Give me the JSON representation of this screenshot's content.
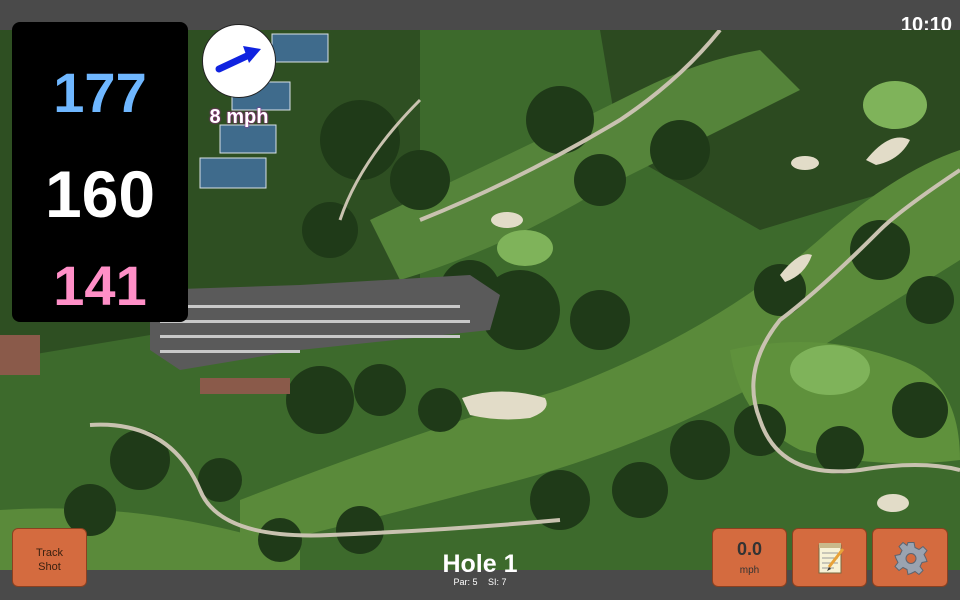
{
  "status": {
    "time": "10:10"
  },
  "distances": {
    "back": "177",
    "middle": "160",
    "front": "141"
  },
  "wind": {
    "speed_label": "8 mph",
    "icon": "wind-direction-arrow-icon"
  },
  "hole": {
    "title": "Hole 1",
    "par_label": "Par: 5",
    "si_label": "SI: 7"
  },
  "buttons": {
    "track_shot_line1": "Track",
    "track_shot_line2": "Shot",
    "speed_value": "0.0",
    "speed_unit": "mph",
    "notes_icon": "notepad-icon",
    "settings_icon": "gear-icon"
  },
  "colors": {
    "back": "#6fb7ff",
    "middle": "#ffffff",
    "front": "#ff8fc7",
    "button": "#d46b3f",
    "bar": "#4a4a4a"
  }
}
